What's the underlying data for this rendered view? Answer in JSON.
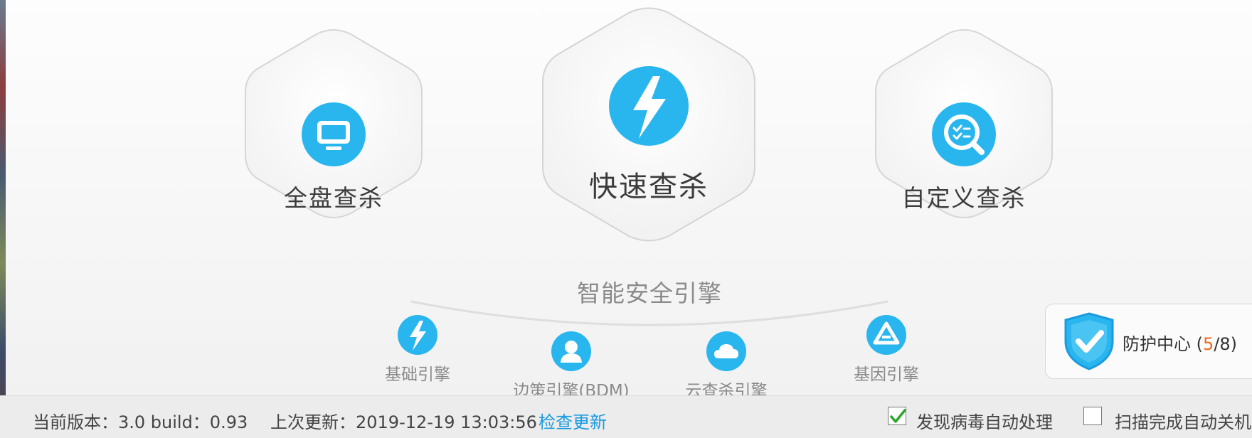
{
  "scan_modes": {
    "full": {
      "label": "全盘查杀",
      "icon": "monitor-icon"
    },
    "quick": {
      "label": "快速查杀",
      "icon": "lightning-icon"
    },
    "custom": {
      "label": "自定义查杀",
      "icon": "search-checklist-icon"
    }
  },
  "engine": {
    "title": "智能安全引擎",
    "items": [
      {
        "label": "基础引擎",
        "icon": "lightning-icon"
      },
      {
        "label": "边策引擎(BDM)",
        "icon": "user-icon"
      },
      {
        "label": "云查杀引擎",
        "icon": "cloud-icon"
      },
      {
        "label": "基因引擎",
        "icon": "gene-triangle-icon"
      }
    ]
  },
  "protection": {
    "label": "防护中心 (",
    "count_active": "5",
    "count_total": "/8)",
    "icon": "shield-check-icon"
  },
  "status": {
    "version": "当前版本：3.0   build：0.93",
    "last_update": "上次更新：2019-12-19 13:03:56",
    "check_update": "检查更新",
    "auto_handle": {
      "label": "发现病毒自动处理",
      "checked": true
    },
    "auto_shutdown": {
      "label": "扫描完成自动关机",
      "checked": false
    }
  },
  "colors": {
    "accent": "#29b6ef",
    "link": "#1a9be0",
    "highlight": "#f06a1e",
    "check": "#2aa52a"
  }
}
